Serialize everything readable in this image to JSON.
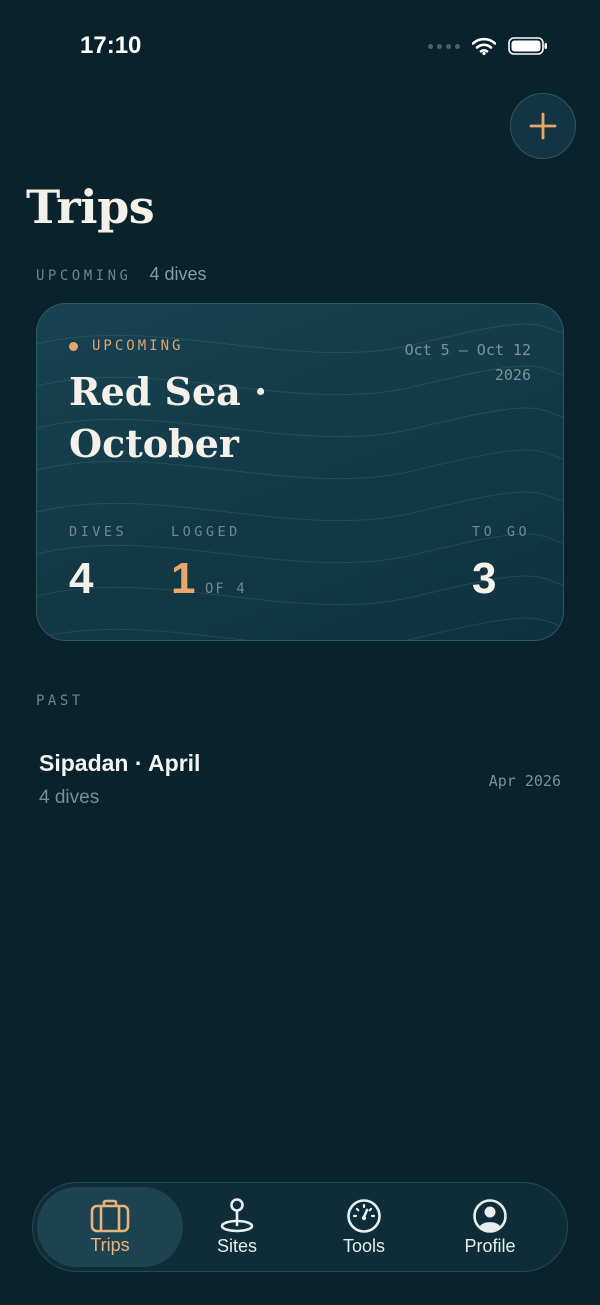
{
  "status_bar": {
    "time": "17:10"
  },
  "header": {
    "title": "Trips",
    "add_button": "plus-icon"
  },
  "upcoming_section": {
    "label": "UPCOMING",
    "count": "4 dives"
  },
  "trip_card": {
    "badge": "UPCOMING",
    "date_range": "Oct 5 — Oct 12",
    "year": "2026",
    "title": "Red Sea · October",
    "stats": {
      "dives_label": "DIVES",
      "dives_value": "4",
      "logged_label": "LOGGED",
      "logged_value": "1",
      "logged_sub": "OF 4",
      "to_go_label": "TO GO",
      "to_go_value": "3"
    }
  },
  "past_section": {
    "label": "PAST",
    "items": [
      {
        "title": "Sipadan · April",
        "subtitle": "4 dives",
        "date": "Apr 2026"
      }
    ]
  },
  "tab_bar": {
    "tabs": [
      {
        "label": "Trips",
        "icon": "suitcase-icon",
        "active": true
      },
      {
        "label": "Sites",
        "icon": "map-pin-icon",
        "active": false
      },
      {
        "label": "Tools",
        "icon": "gauge-icon",
        "active": false
      },
      {
        "label": "Profile",
        "icon": "profile-icon",
        "active": false
      }
    ]
  },
  "colors": {
    "background": "#0a222c",
    "accent": "#e8a76a",
    "card": "#143c4a",
    "text": "#f4f1e9"
  }
}
